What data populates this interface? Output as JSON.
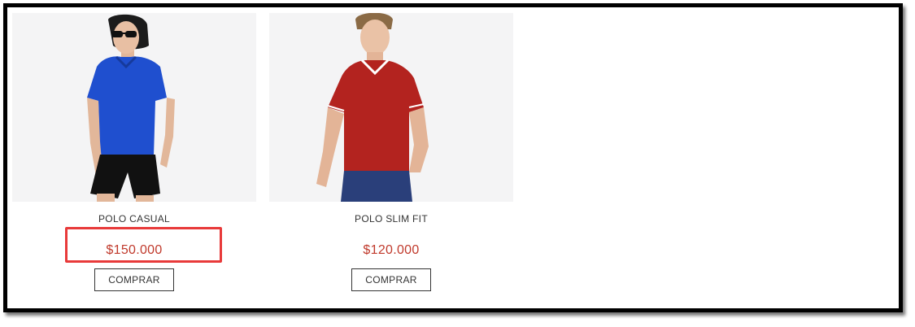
{
  "products": [
    {
      "name": "POLO CASUAL",
      "price": "$150.000",
      "button_label": "COMPRAR",
      "image": "woman-in-blue-polo-shirt",
      "shirt_color": "#1f4fcf",
      "highlighted": true
    },
    {
      "name": "POLO SLIM FIT",
      "price": "$120.000",
      "button_label": "COMPRAR",
      "image": "man-in-red-polo-shirt",
      "shirt_color": "#b3231f",
      "highlighted": false
    }
  ],
  "colors": {
    "price": "#c0392b",
    "highlight_box": "#e83a3a",
    "frame": "#000000"
  }
}
